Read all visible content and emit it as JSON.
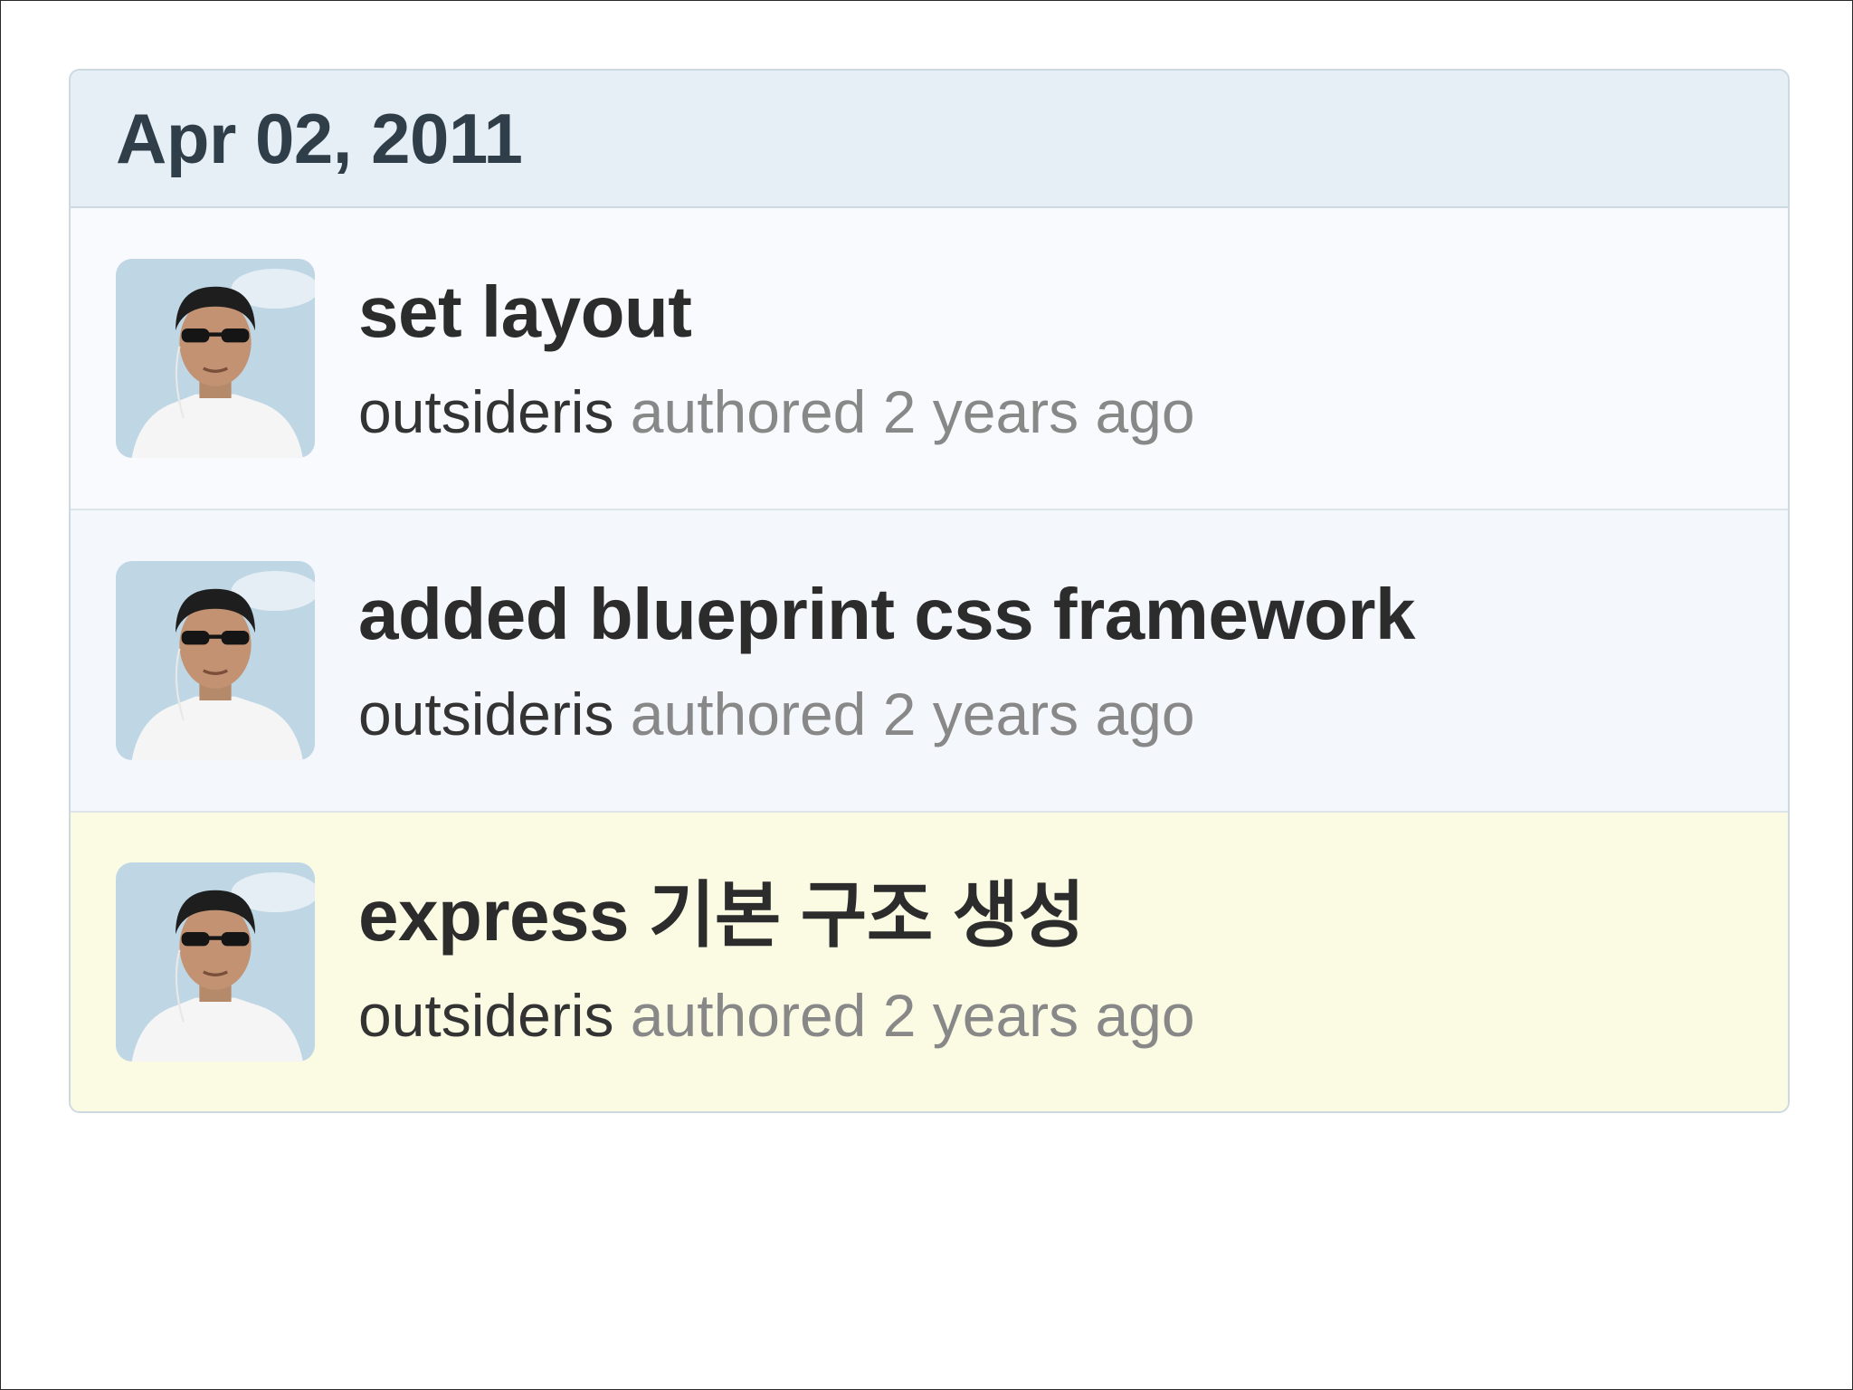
{
  "group": {
    "date": "Apr 02, 2011"
  },
  "commits": [
    {
      "message": "set layout",
      "author": "outsideris",
      "meta_suffix": " authored 2 years ago"
    },
    {
      "message": "added blueprint css framework",
      "author": "outsideris",
      "meta_suffix": " authored 2 years ago"
    },
    {
      "message": "express 기본 구조 생성",
      "author": "outsideris",
      "meta_suffix": " authored 2 years ago"
    }
  ]
}
